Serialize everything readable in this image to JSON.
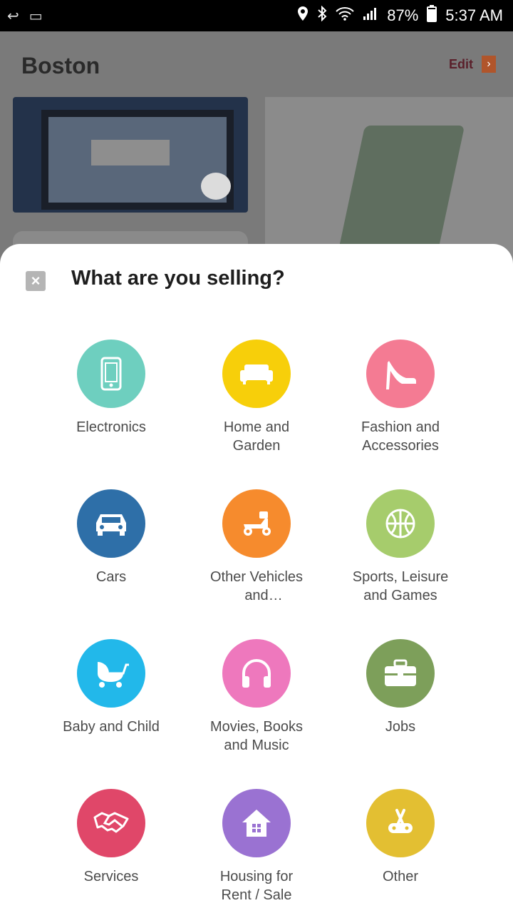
{
  "status_bar": {
    "time": "5:37 AM",
    "battery": "87%",
    "icons": [
      "location-icon",
      "bluetooth-icon",
      "wifi-icon",
      "signal-icon",
      "battery-icon"
    ]
  },
  "background": {
    "title": "Boston",
    "edit_label": "Edit"
  },
  "sheet": {
    "title": "What are you selling?",
    "categories": [
      {
        "label": "Electronics",
        "icon": "phone-icon",
        "color": "#6ecfbf"
      },
      {
        "label": "Home and Garden",
        "icon": "sofa-icon",
        "color": "#f7cf0a"
      },
      {
        "label": "Fashion and Accessories",
        "icon": "high-heel-icon",
        "color": "#f47b93"
      },
      {
        "label": "Cars",
        "icon": "car-icon",
        "color": "#2e6fa8"
      },
      {
        "label": "Other Vehicles and Accessories",
        "icon": "scooter-icon",
        "color": "#f68b2d"
      },
      {
        "label": "Sports, Leisure and Games",
        "icon": "basketball-icon",
        "color": "#a6cc6c"
      },
      {
        "label": "Baby and Child",
        "icon": "stroller-icon",
        "color": "#22b8ea"
      },
      {
        "label": "Movies, Books and Music",
        "icon": "headphones-icon",
        "color": "#ee78bd"
      },
      {
        "label": "Jobs",
        "icon": "briefcase-icon",
        "color": "#7d9f5a"
      },
      {
        "label": "Services",
        "icon": "handshake-icon",
        "color": "#e04769"
      },
      {
        "label": "Housing for Rent / Sale",
        "icon": "house-icon",
        "color": "#9a72d2"
      },
      {
        "label": "Other",
        "icon": "multitool-icon",
        "color": "#e3bf32"
      }
    ]
  }
}
